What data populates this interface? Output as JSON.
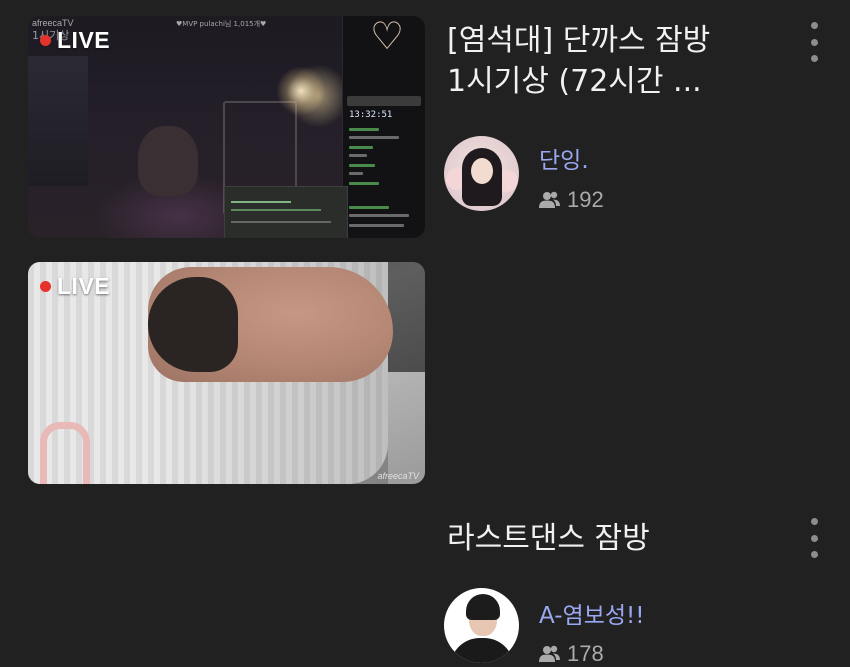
{
  "streams": [
    {
      "live_label": "LIVE",
      "title_line1": "[염석대] 단까스 잠방",
      "title_line2": "1시기상 (72시간 ...",
      "streamer": "단잉.",
      "viewers": "192",
      "thumb_brand": "afreecaTV",
      "thumb_overlay": "1시기상",
      "chat_time": "13:32:51",
      "thumb_top_text": "♥MVP pulachi님 1,015개♥"
    },
    {
      "live_label": "LIVE",
      "title_line1": "라스트댄스 잠방",
      "streamer": "A-염보성!!",
      "viewers": "178",
      "thumb_brand": "afreecaTV"
    }
  ],
  "icons": {
    "viewers": "users-icon",
    "more": "more-vertical-icon",
    "live_dot": "live-dot-icon"
  },
  "colors": {
    "background": "#212121",
    "live_dot": "#e5322b",
    "streamer_name": "#9aa8f2",
    "viewer_count": "#aaaaaa"
  }
}
